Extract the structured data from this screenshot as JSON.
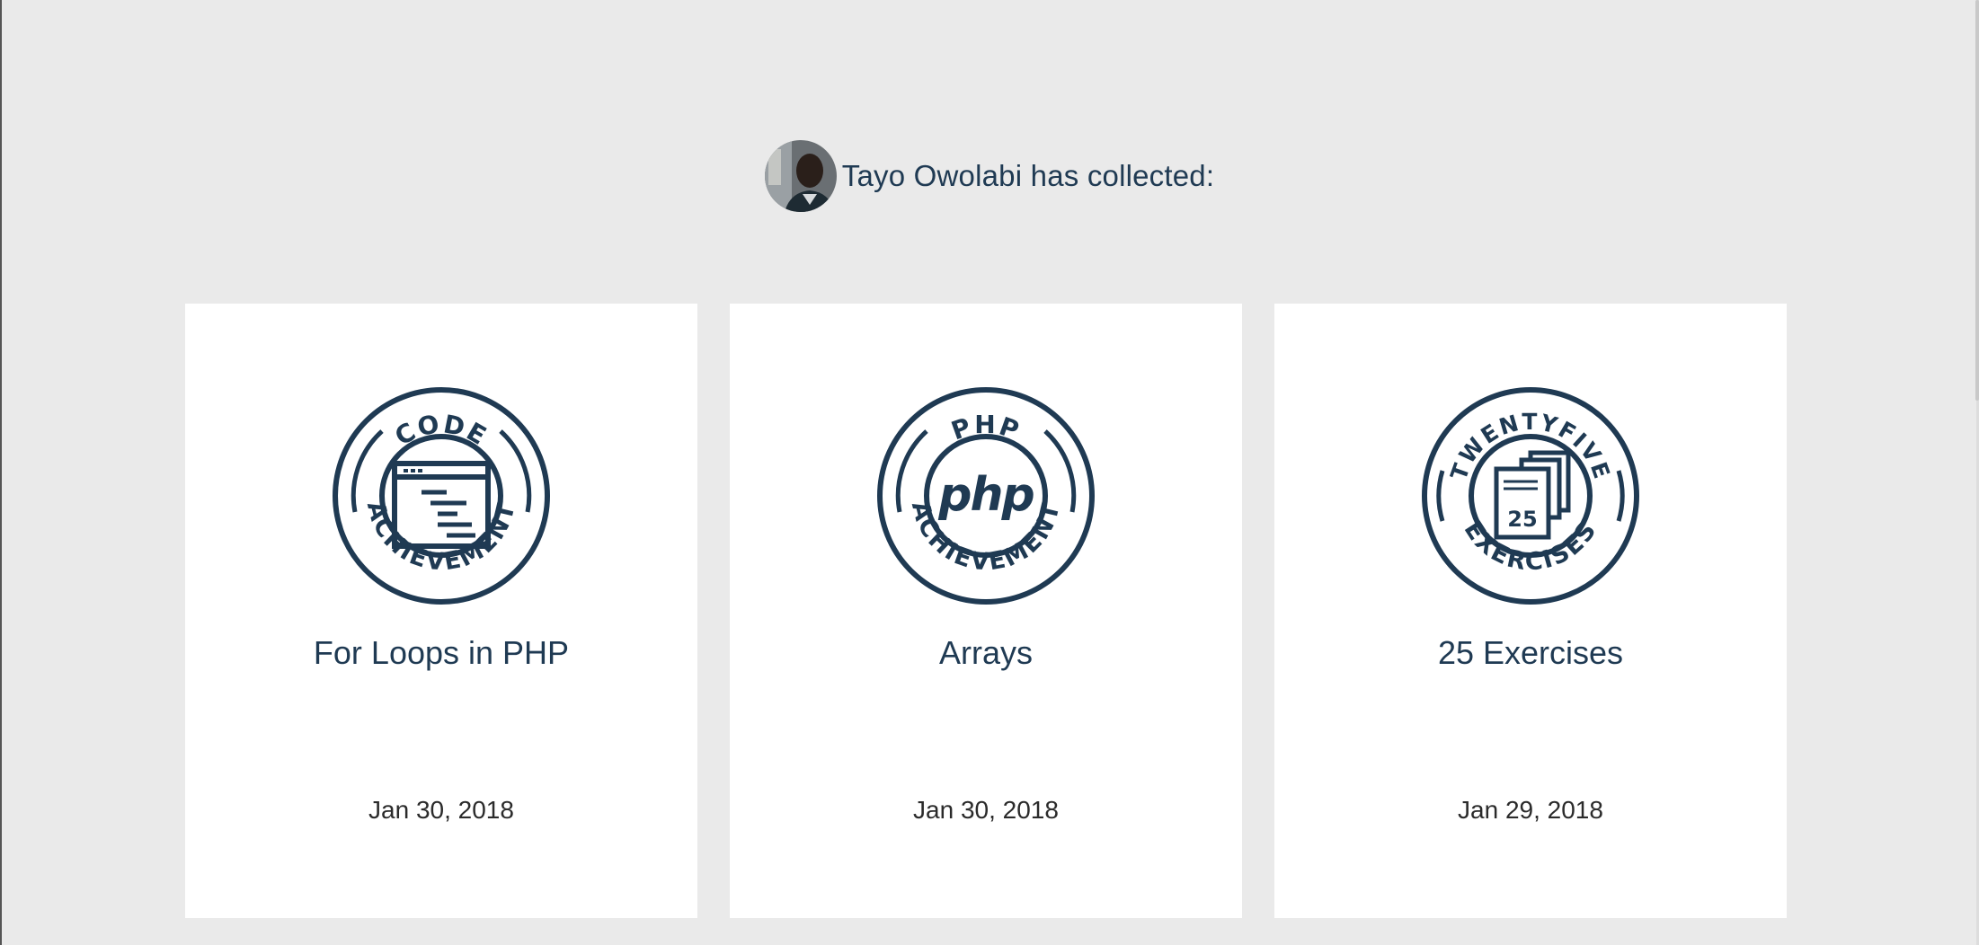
{
  "collector": {
    "user_name": "Tayo Owolabi",
    "suffix": "has collected:"
  },
  "achievements": [
    {
      "title": "For Loops in PHP",
      "date": "Jan 30, 2018",
      "badge": {
        "top_text": "CODE",
        "bottom_text": "ACHIEVEMENT",
        "icon": "code-window-icon"
      }
    },
    {
      "title": "Arrays",
      "date": "Jan 30, 2018",
      "badge": {
        "top_text": "PHP",
        "bottom_text": "ACHIEVEMENT",
        "icon": "php-logo-icon",
        "center_text": "php"
      }
    },
    {
      "title": "25 Exercises",
      "date": "Jan 29, 2018",
      "badge": {
        "top_text": "TWENTYFIVE",
        "bottom_text": "EXERCISES",
        "icon": "stacked-pages-icon",
        "center_text": "25"
      }
    }
  ],
  "colors": {
    "background": "#eaeaea",
    "card": "#ffffff",
    "accent": "#1f3a53",
    "date_text": "#2b2b2b"
  }
}
